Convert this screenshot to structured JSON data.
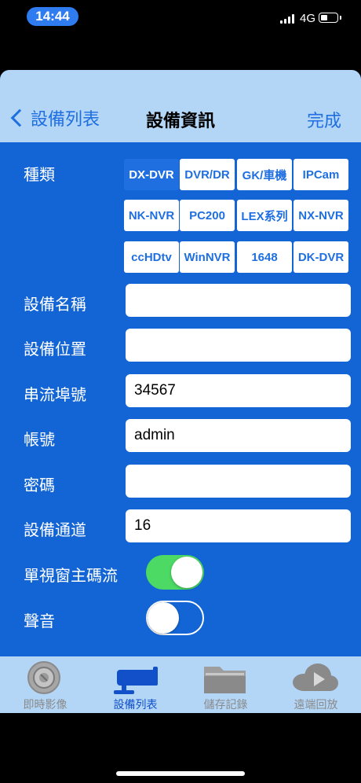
{
  "status_bar": {
    "time": "14:44",
    "network": "4G"
  },
  "nav": {
    "back_label": "設備列表",
    "title": "設備資訊",
    "done_label": "完成"
  },
  "form": {
    "type_label": "種類",
    "types": [
      "DX-DVR",
      "DVR/DR",
      "GK/車機",
      "IPCam",
      "NK-NVR",
      "PC200",
      "LEX系列",
      "NX-NVR",
      "ccHDtv",
      "WinNVR",
      "1648",
      "DK-DVR"
    ],
    "selected_type": "DX-DVR",
    "device_name": {
      "label": "設備名稱",
      "value": ""
    },
    "device_location": {
      "label": "設備位置",
      "value": ""
    },
    "stream_port": {
      "label": "串流埠號",
      "value": "34567"
    },
    "account": {
      "label": "帳號",
      "value": "admin"
    },
    "password": {
      "label": "密碼",
      "value": ""
    },
    "channels": {
      "label": "設備通道",
      "value": "16"
    },
    "single_view_main_stream": {
      "label": "單視窗主碼流",
      "on": true
    },
    "audio": {
      "label": "聲音",
      "on": false
    }
  },
  "tabbar": {
    "items": [
      {
        "label": "即時影像",
        "icon": "camera-lens-icon",
        "active": false
      },
      {
        "label": "設備列表",
        "icon": "cctv-camera-icon",
        "active": true
      },
      {
        "label": "儲存記錄",
        "icon": "folder-icon",
        "active": false
      },
      {
        "label": "遠端回放",
        "icon": "cloud-play-icon",
        "active": false
      }
    ]
  },
  "colors": {
    "accent": "#1f6fe0",
    "panel": "#1365d6",
    "bar": "#b3d6f7",
    "toggle_on": "#4cd964"
  }
}
